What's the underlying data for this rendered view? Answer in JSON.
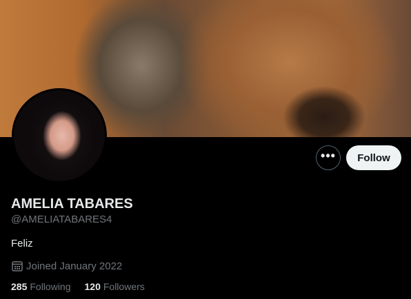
{
  "profile": {
    "name": "AMELIA TABARES",
    "handle": "@AMELIATABARES4",
    "bio": "Feliz",
    "joined": "Joined January 2022",
    "following_count": "285",
    "following_label": "Following",
    "followers_count": "120",
    "followers_label": "Followers"
  },
  "actions": {
    "more_label": "•••",
    "follow_label": "Follow"
  },
  "icons": {
    "more": "more-horizontal-icon",
    "calendar": "calendar-icon"
  },
  "colors": {
    "background": "#000000",
    "follow_button_bg": "#eff3f4",
    "secondary_text": "#71767b"
  }
}
